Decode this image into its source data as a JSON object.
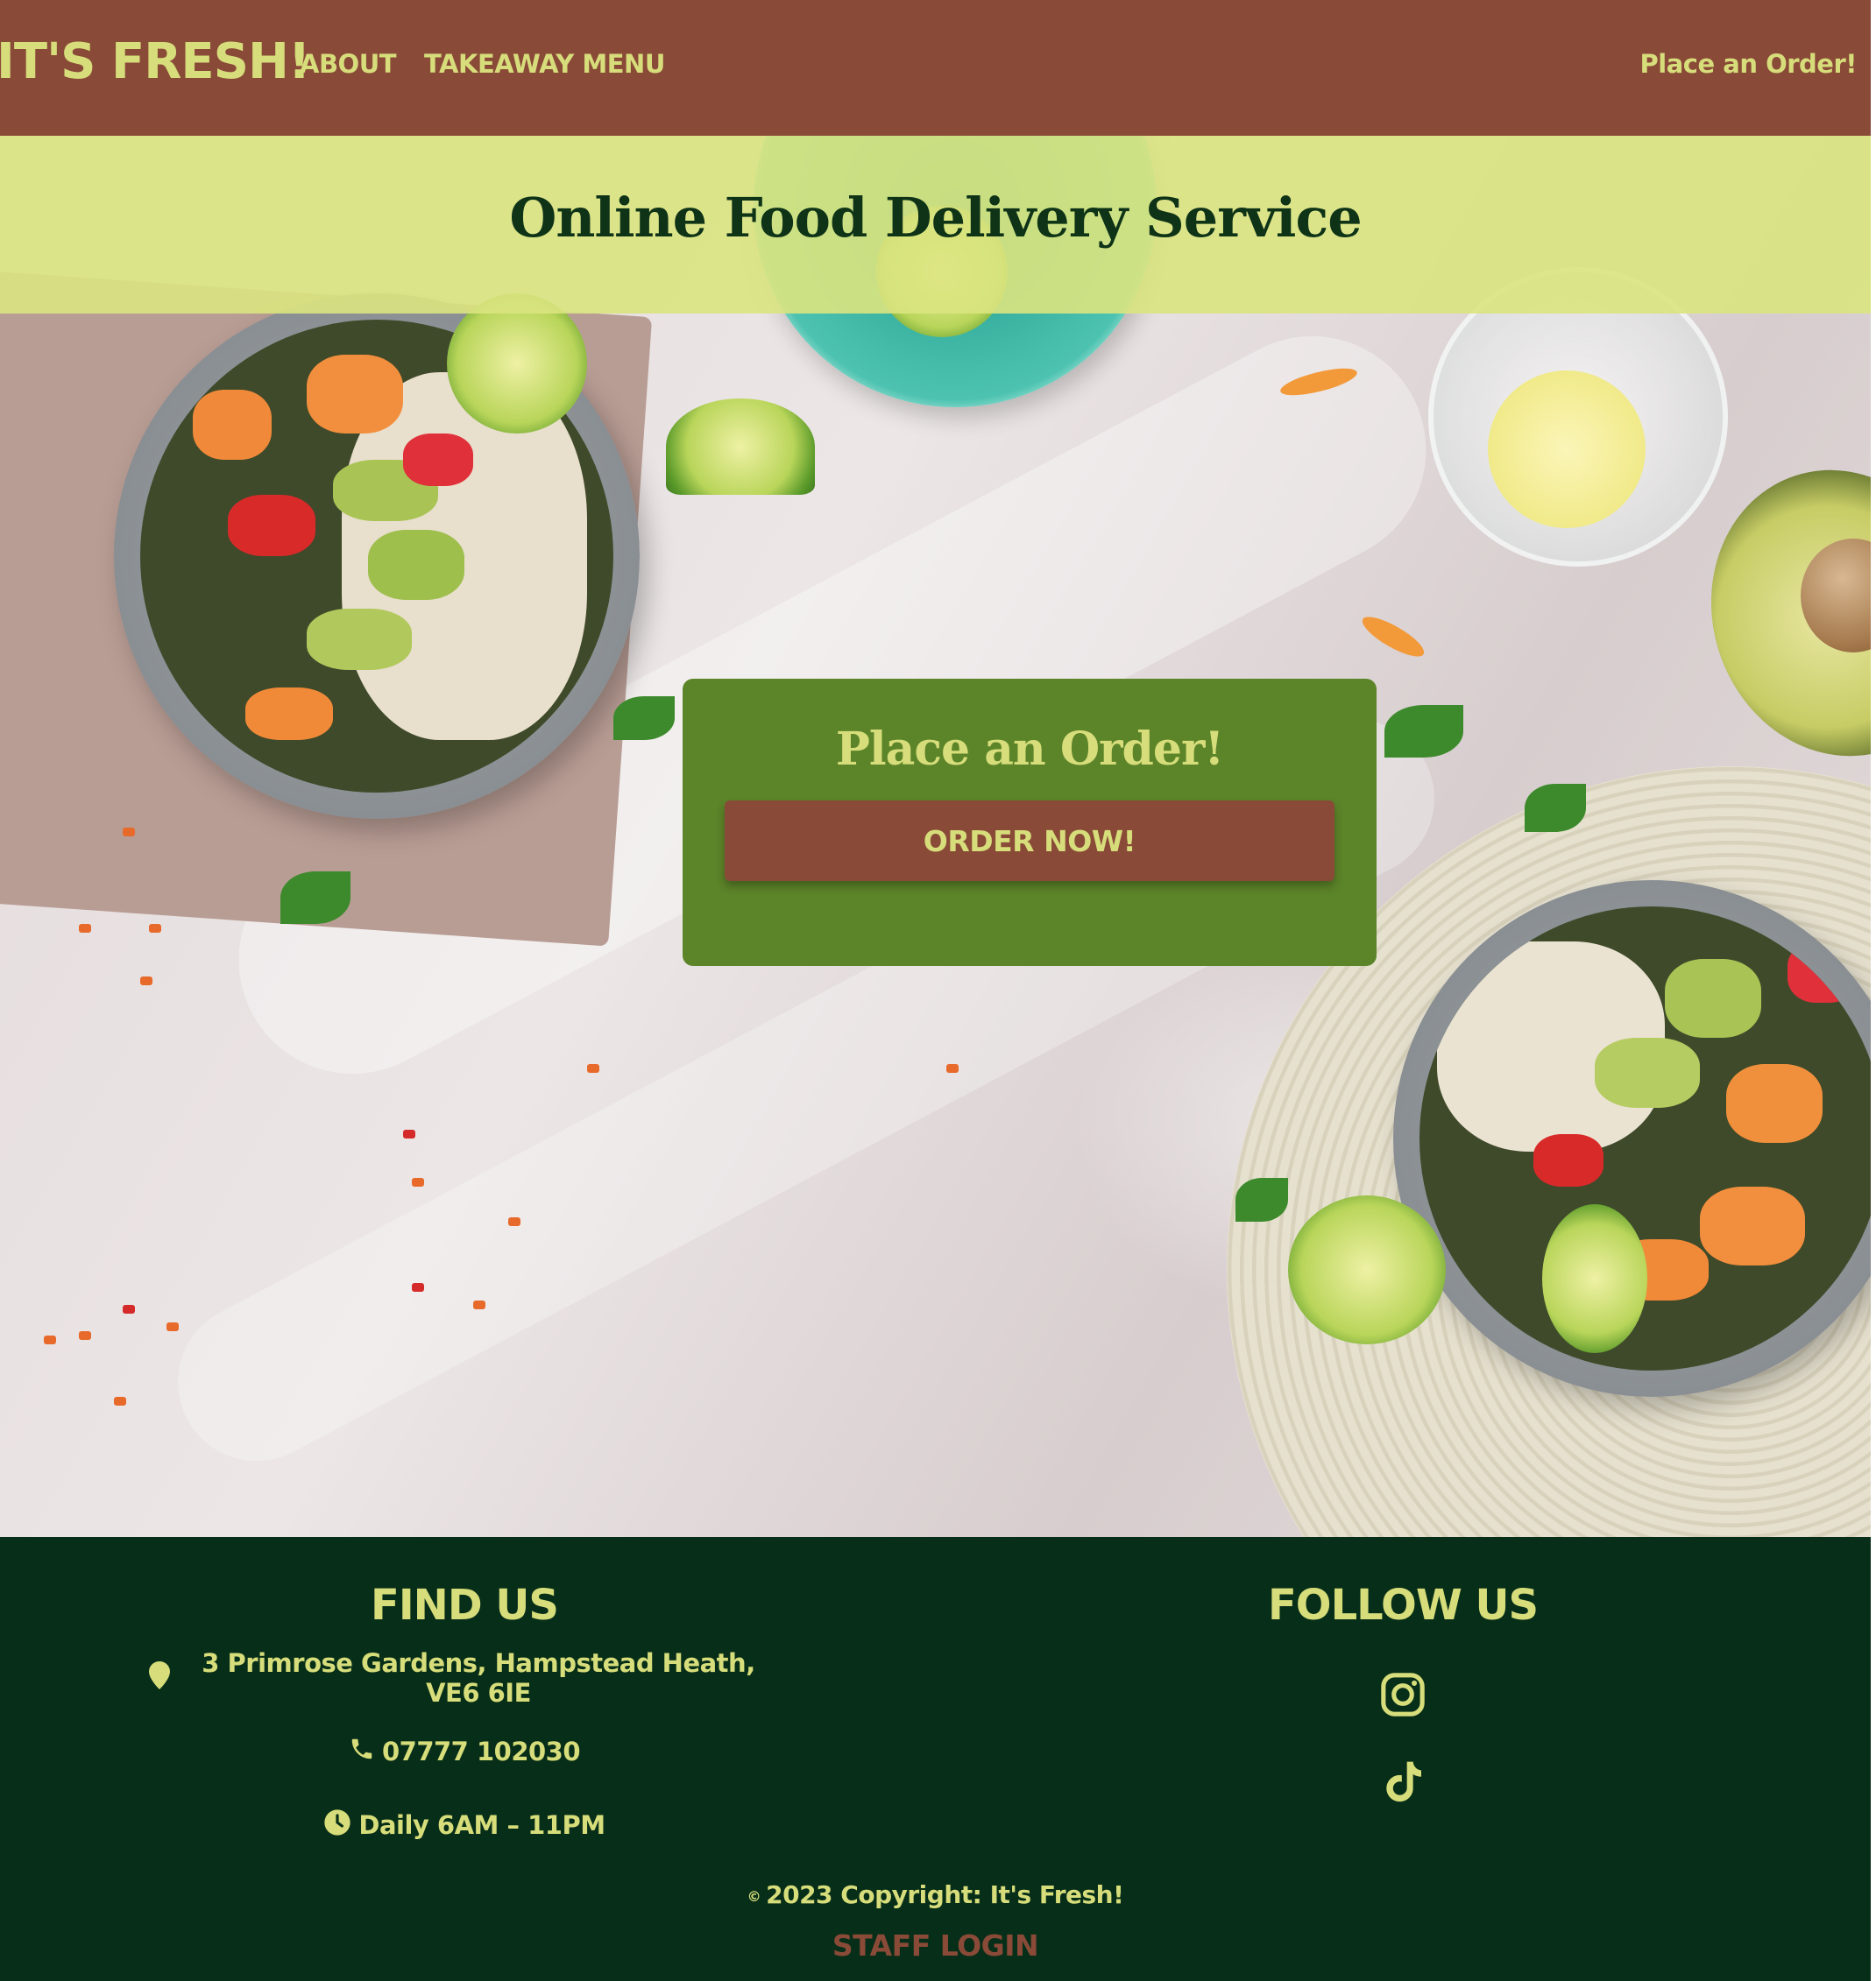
{
  "navbar": {
    "brand": "IT'S FRESH!",
    "links": [
      "ABOUT",
      "TAKEAWAY MENU"
    ],
    "order_link": "Place an Order!"
  },
  "hero": {
    "title": "Online Food Delivery Service",
    "order_card": {
      "title": "Place an Order!",
      "button_label": "ORDER NOW!"
    }
  },
  "footer": {
    "find_us": {
      "heading": "FIND US",
      "address": "3 Primrose Gardens, Hampstead Heath, VE6 6IE",
      "phone": "07777 102030",
      "hours": "Daily 6AM – 11PM"
    },
    "follow_us": {
      "heading": "FOLLOW US",
      "icons": [
        "instagram-icon",
        "tiktok-icon"
      ]
    },
    "copyright_symbol": "©",
    "copyright": "2023 Copyright: It's Fresh!",
    "staff_login": "STAFF LOGIN"
  },
  "colors": {
    "nav_bg": "#8a4a38",
    "accent_text": "#d6dd7a",
    "title_band": "#dae480",
    "title_text": "#0e3317",
    "card_bg": "#5c8429",
    "footer_bg": "#072e18"
  }
}
